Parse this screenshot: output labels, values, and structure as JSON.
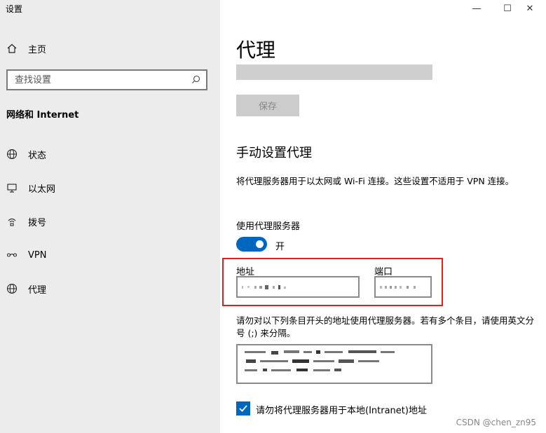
{
  "window": {
    "title": "设置",
    "controls": {
      "minimize": "—",
      "maximize": "☐",
      "close": "✕"
    }
  },
  "sidebar": {
    "home_label": "主页",
    "search_placeholder": "查找设置",
    "section_title": "网络和 Internet",
    "items": [
      {
        "label": "状态",
        "icon": "globe-icon"
      },
      {
        "label": "以太网",
        "icon": "ethernet-monitor-icon"
      },
      {
        "label": "拨号",
        "icon": "dialup-icon"
      },
      {
        "label": "VPN",
        "icon": "vpn-icon"
      },
      {
        "label": "代理",
        "icon": "globe-icon"
      }
    ]
  },
  "main": {
    "page_title": "代理",
    "save_label": "保存",
    "section_title": "手动设置代理",
    "description": "将代理服务器用于以太网或 Wi-Fi 连接。这些设置不适用于 VPN 连接。",
    "use_proxy_label": "使用代理服务器",
    "toggle_state": "开",
    "address_label": "地址",
    "port_label": "端口",
    "exceptions_description": "请勿对以下列条目开头的地址使用代理服务器。若有多个条目，请使用英文分号 (;) 来分隔。",
    "bypass_local_label": "请勿将代理服务器用于本地(Intranet)地址",
    "bypass_local_checked": true
  },
  "watermark": "CSDN @chen_zn95",
  "colors": {
    "accent": "#0067c0",
    "highlight_box": "#e0201c",
    "sidebar_bg": "#ececec"
  }
}
